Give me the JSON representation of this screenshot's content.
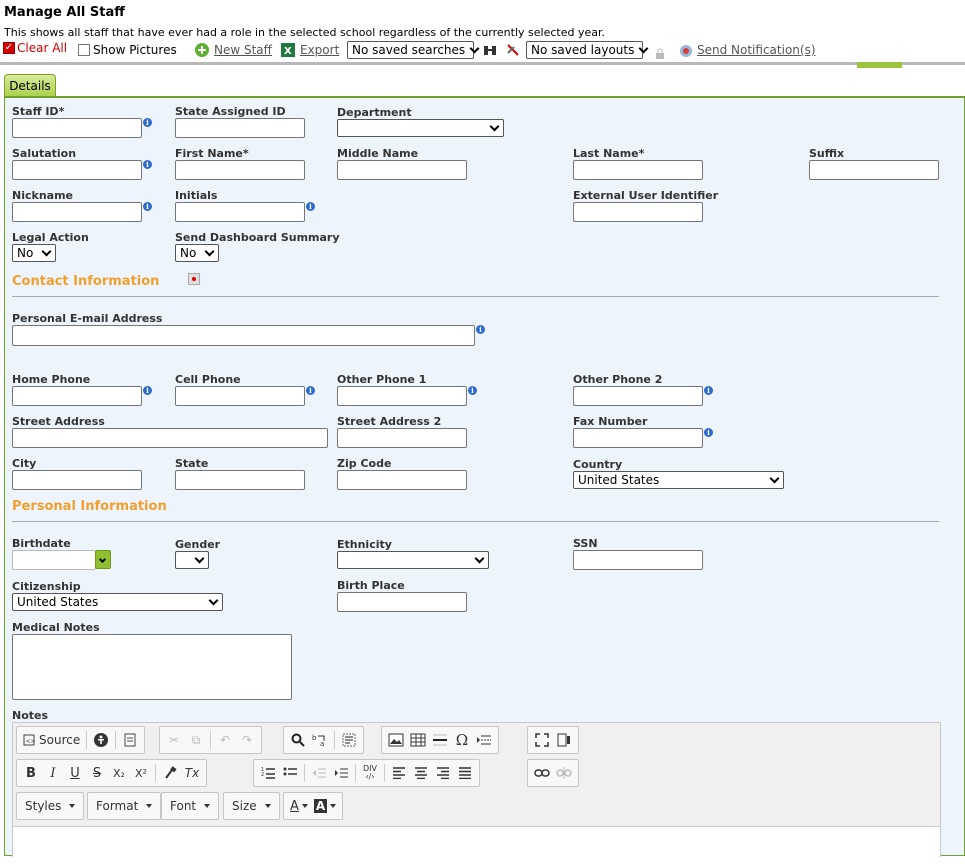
{
  "page": {
    "title": "Manage All Staff",
    "subtitle": "This shows all staff that have ever had a role in the selected school regardless of the currently selected year."
  },
  "toolbar": {
    "clear_all": "Clear All",
    "show_pictures": "Show Pictures",
    "new_staff": "New Staff",
    "export": "Export",
    "saved_searches": "No saved searches",
    "saved_layouts": "No saved layouts",
    "send_notifications": "Send Notification(s)"
  },
  "tab": {
    "details": "Details"
  },
  "fields": {
    "staff_id": "Staff ID*",
    "state_assigned_id": "State Assigned ID",
    "department": "Department",
    "salutation": "Salutation",
    "first_name": "First Name*",
    "middle_name": "Middle Name",
    "last_name": "Last Name*",
    "suffix": "Suffix",
    "nickname": "Nickname",
    "initials": "Initials",
    "external_user_identifier": "External User Identifier",
    "legal_action": "Legal Action",
    "legal_action_value": "No",
    "send_dashboard_summary": "Send Dashboard Summary",
    "send_dashboard_summary_value": "No",
    "personal_email": "Personal E-mail Address",
    "home_phone": "Home Phone",
    "cell_phone": "Cell Phone",
    "other_phone_1": "Other Phone 1",
    "other_phone_2": "Other Phone 2",
    "street_address": "Street Address",
    "street_address_2": "Street Address 2",
    "fax_number": "Fax Number",
    "city": "City",
    "state": "State",
    "zip_code": "Zip Code",
    "country": "Country",
    "country_value": "United States",
    "birthdate": "Birthdate",
    "gender": "Gender",
    "ethnicity": "Ethnicity",
    "ssn": "SSN",
    "citizenship": "Citizenship",
    "citizenship_value": "United States",
    "birth_place": "Birth Place",
    "medical_notes": "Medical Notes",
    "notes": "Notes"
  },
  "sections": {
    "contact": "Contact Information",
    "personal": "Personal Information"
  },
  "editor": {
    "source": "Source",
    "bold": "B",
    "italic": "I",
    "underline": "U",
    "strike": "S",
    "subscript": "X₂",
    "superscript": "X²",
    "remove_format": "Tx",
    "styles": "Styles",
    "format": "Format",
    "font": "Font",
    "size": "Size",
    "text_color": "A",
    "bg_color": "A"
  },
  "colors": {
    "section_heading": "#f0a030",
    "panel_bg": "#edf4fb",
    "tab_green": "#a9d04b",
    "info_icon": "#2e6bcf"
  }
}
